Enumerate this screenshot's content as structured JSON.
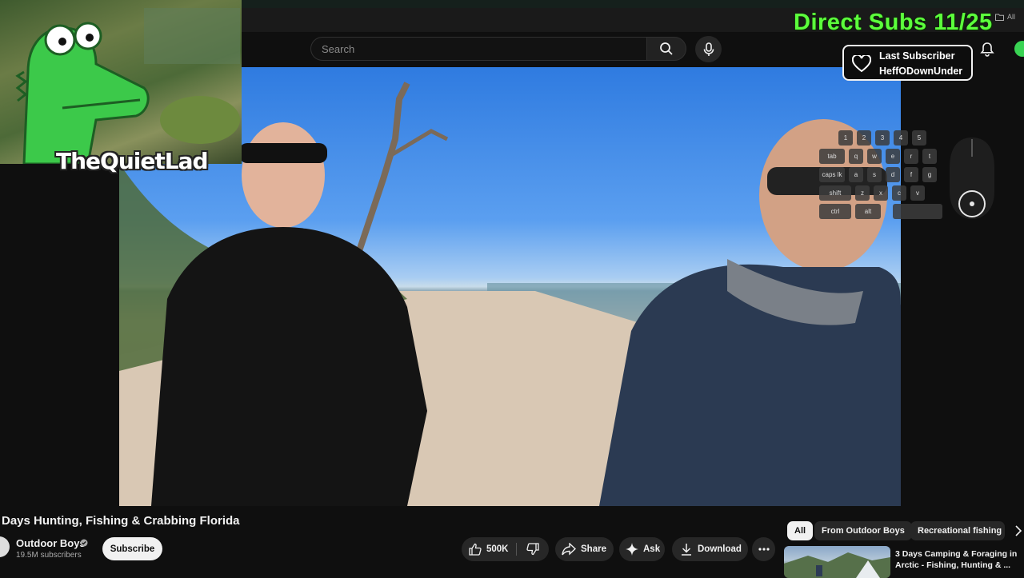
{
  "masthead": {
    "search_placeholder": "Search",
    "folder_label": "All"
  },
  "overlay": {
    "subs_goal": "Direct Subs 11/25",
    "last_subscriber_label": "Last Subscriber",
    "last_subscriber_name": "HeffODownUnder",
    "streamer_name": "TheQuietLad",
    "keyboard_rows": [
      [
        "1",
        "2",
        "3",
        "4",
        "5"
      ],
      [
        "tab",
        "q",
        "w",
        "e",
        "r",
        "t"
      ],
      [
        "caps lk",
        "a",
        "s",
        "d",
        "f",
        "g"
      ],
      [
        "shift",
        "z",
        "x",
        "c",
        "v"
      ],
      [
        "ctrl",
        "alt"
      ]
    ]
  },
  "video": {
    "title": "Days Hunting, Fishing & Crabbing Florida",
    "channel_name": "Outdoor Boys",
    "subscriber_count": "19.5M subscribers",
    "subscribe_label": "Subscribe",
    "like_count": "500K",
    "share_label": "Share",
    "ask_label": "Ask",
    "download_label": "Download"
  },
  "recommendations": {
    "chips": [
      "All",
      "From Outdoor Boys",
      "Recreational fishing"
    ],
    "items": [
      {
        "title": "3 Days Camping & Foraging in Arctic - Fishing, Hunting & ..."
      }
    ]
  },
  "colors": {
    "goal_text": "#5cff3c",
    "page_bg": "#0f0f0f",
    "pill_bg": "#272727"
  }
}
